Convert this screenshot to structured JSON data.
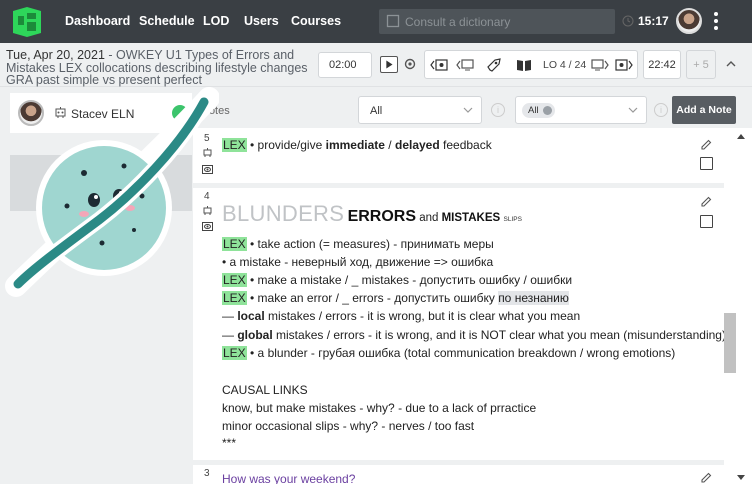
{
  "nav": {
    "items": [
      "Dashboard",
      "Schedule",
      "LOD",
      "Users",
      "Courses"
    ],
    "search_placeholder": "Consult a dictionary",
    "time": "15:17"
  },
  "lesson": {
    "date": "Tue, Apr 20, 2021",
    "title": " - OWKEY U1 Types of Errors and Mistakes LEX collocations describing lifestyle changes GRA past simple vs present perfect",
    "timer": "02:00",
    "lo_label": "LO 4 / 24",
    "end_time": "22:42",
    "plus5": "+ 5"
  },
  "student": {
    "name": "Stacev ELN"
  },
  "filters": {
    "notes_label": "Notes",
    "select1_value": "All",
    "select2_chip": "All",
    "info": "i",
    "add_note": "Add a Note"
  },
  "notes": {
    "note5": {
      "number": "5",
      "lex": "LEX",
      "pre": " • provide/give ",
      "b1": "immediate",
      "mid": " / ",
      "b2": "delayed",
      "post": " feedback"
    },
    "note4": {
      "number": "4",
      "big": "BLUNDERS",
      "errors": "ERRORS",
      "and1": " and ",
      "mistakes": "MISTAKES",
      "slips": "SLIPS",
      "l1_lex": "LEX",
      "l1": " • take action (= measures) - принимать меры",
      "l2": "• a mistake - неверный ход, движение => ошибка",
      "l3_lex": "LEX",
      "l3": " • make a mistake / _ mistakes  - допустить ошибку / ошибки",
      "l4_lex": "LEX",
      "l4": " • make an error / _ errors - допустить ошибку ",
      "l4_hl": "по незнанию",
      "l5_pre": "— ",
      "l5_b": "local",
      "l5": " mistakes / errors - it is wrong, but it is clear what you mean",
      "l6_pre": "— ",
      "l6_b": "global",
      "l6": " mistakes / errors - it is wrong, and it is NOT clear what you mean (misunderstanding)",
      "l7_lex": "LEX",
      "l7": " • a blunder - грубая ошибка (total communication breakdown / wrong emotions)",
      "l8": "CAUSAL LINKS",
      "l9": "know, but make mistakes - why? - due to a lack of prractice",
      "l10": "minor occasional slips - why? - nerves  / too fast",
      "l11": "***"
    },
    "note3": {
      "number": "3",
      "text": "How was your weekend?"
    }
  },
  "colors": {
    "navbar": "#3a3f44",
    "lex_highlight": "#8fe39a",
    "online": "#3cc46c",
    "add_note_bg": "#585d62"
  }
}
